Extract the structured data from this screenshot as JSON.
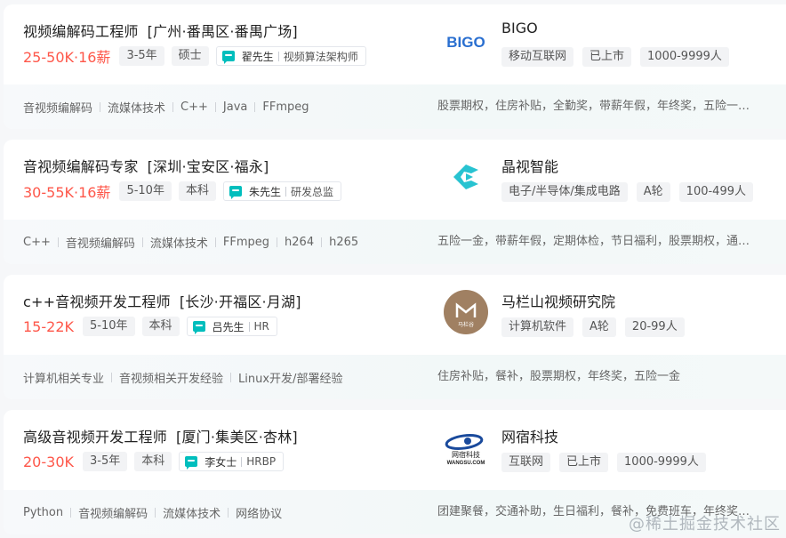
{
  "jobs": [
    {
      "title": "视频编解码工程师",
      "location": "[广州·番禺区·番禺广场]",
      "salary": "25-50K·16薪",
      "experience": "3-5年",
      "education": "硕士",
      "recruiter_name": "翟先生",
      "recruiter_title": "视频算法架构师",
      "skills": [
        "音视频编解码",
        "流媒体技术",
        "C++",
        "Java",
        "FFmpeg"
      ],
      "company": "BIGO",
      "company_tags": [
        "移动互联网",
        "已上市",
        "1000-9999人"
      ],
      "benefits": "股票期权，住房补贴，全勤奖，带薪年假，年终奖，五险一金，定期体检",
      "logo_text": "BIGO"
    },
    {
      "title": "音视频编解码专家",
      "location": "[深圳·宝安区·福永]",
      "salary": "30-55K·16薪",
      "experience": "5-10年",
      "education": "本科",
      "recruiter_name": "朱先生",
      "recruiter_title": "研发总监",
      "skills": [
        "C++",
        "音视频编解码",
        "流媒体技术",
        "FFmpeg",
        "h264",
        "h265"
      ],
      "company": "晶视智能",
      "company_tags": [
        "电子/半导体/集成电路",
        "A轮",
        "100-499人"
      ],
      "benefits": "五险一金，带薪年假，定期体检，节日福利，股票期权，通讯补贴",
      "logo_text": ""
    },
    {
      "title": "c++音视频开发工程师",
      "location": "[长沙·开福区·月湖]",
      "salary": "15-22K",
      "experience": "5-10年",
      "education": "本科",
      "recruiter_name": "吕先生",
      "recruiter_title": "HR",
      "skills": [
        "计算机相关专业",
        "音视频相关开发经验",
        "Linux开发/部署经验"
      ],
      "company": "马栏山视频研究院",
      "company_tags": [
        "计算机软件",
        "A轮",
        "20-99人"
      ],
      "benefits": "住房补贴，餐补，股票期权，年终奖，五险一金",
      "logo_text": "马栏谷"
    },
    {
      "title": "高级音视频开发工程师",
      "location": "[厦门·集美区·杏林]",
      "salary": "20-30K",
      "experience": "3-5年",
      "education": "本科",
      "recruiter_name": "李女士",
      "recruiter_title": "HRBP",
      "skills": [
        "Python",
        "音视频编解码",
        "流媒体技术",
        "网络协议"
      ],
      "company": "网宿科技",
      "company_tags": [
        "互联网",
        "已上市",
        "1000-9999人"
      ],
      "benefits": "团建聚餐，交通补助，生日福利，餐补，免费班车，年终奖，五险一金",
      "logo_text": "网宿科技",
      "logo_subtext": "WANGSU.COM"
    }
  ],
  "watermark": "@稀土掘金技术社区",
  "colors": {
    "salary": "#fe574a",
    "accent": "#00bebd",
    "bigo": "#2a6fd0"
  }
}
